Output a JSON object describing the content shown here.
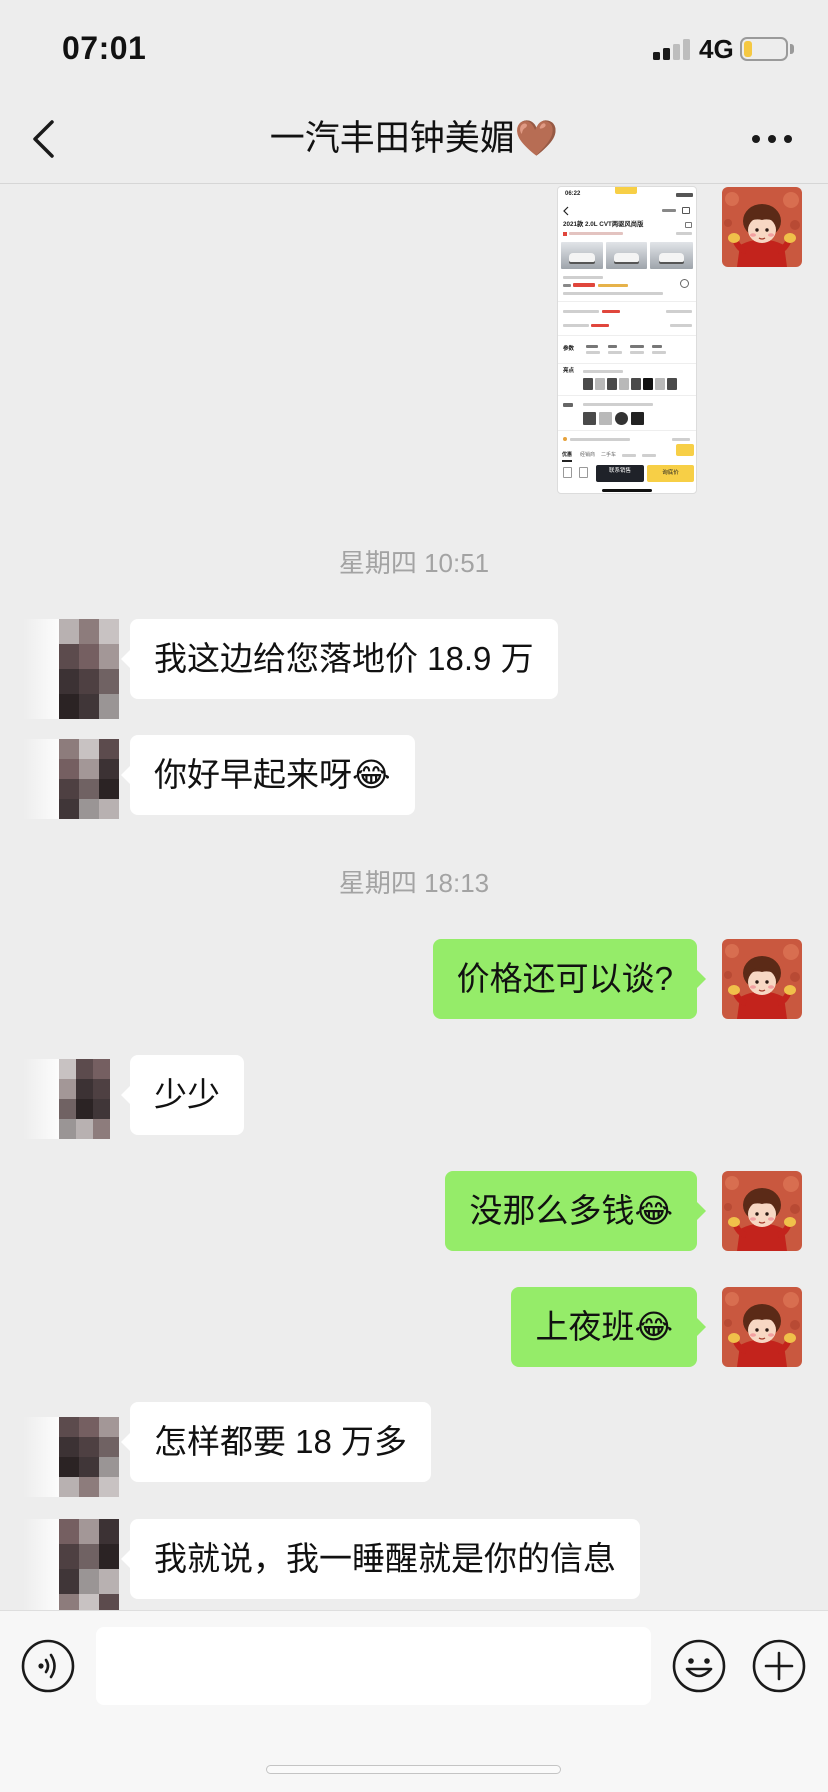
{
  "theme": {
    "background": "#ededed",
    "sent_bubble": "#95ec69",
    "received_bubble": "#ffffff",
    "battery_fill": "#f5c842",
    "accent": "#f7cf46"
  },
  "status_bar": {
    "time": "07:01",
    "network": "4G",
    "signal_level": 2,
    "signal_max": 4,
    "battery_level": 0.2,
    "icons": [
      "signal-icon",
      "battery-icon"
    ]
  },
  "nav": {
    "title": "一汽丰田钟美媚🤎",
    "icons": [
      "chevron-left-icon",
      "more-icon"
    ]
  },
  "chat": {
    "image_message": {
      "side": "right",
      "thumbnail": {
        "time": "06:22",
        "title": "2021款 2.0L CVT两驱风尚版",
        "section_params": "参数",
        "section_highlights": "亮点",
        "tabs": [
          "优惠",
          "经销商",
          "二手车"
        ],
        "contact_button": "联系销售",
        "price_button": "询底价"
      }
    },
    "timestamps": [
      "星期四 10:51",
      "星期四 18:13"
    ],
    "messages": [
      {
        "side": "left",
        "text": "我这边给您落地价 18.9 万"
      },
      {
        "side": "left",
        "text": "你好早起来呀😂"
      },
      {
        "side": "right",
        "text": "价格还可以谈?"
      },
      {
        "side": "left",
        "text": "少少"
      },
      {
        "side": "right",
        "text": "没那么多钱😂"
      },
      {
        "side": "right",
        "text": "上夜班😂"
      },
      {
        "side": "left",
        "text": "怎样都要 18 万多"
      },
      {
        "side": "left",
        "text": "我就说，我一睡醒就是你的信息"
      }
    ]
  },
  "avatars": {
    "contact": "blurred-avatar",
    "self": "cartoon-avatar",
    "mosaic_colors": [
      "#b8b1b1",
      "#8d7c7c",
      "#c8c2c2",
      "#5c4b4d",
      "#755f61",
      "#a39797",
      "#3c3234",
      "#4e4042",
      "#706263",
      "#2b2324",
      "#403638",
      "#9a9595"
    ]
  },
  "input_bar": {
    "value": "",
    "icons": [
      "voice-icon",
      "emoji-icon",
      "plus-icon"
    ]
  }
}
